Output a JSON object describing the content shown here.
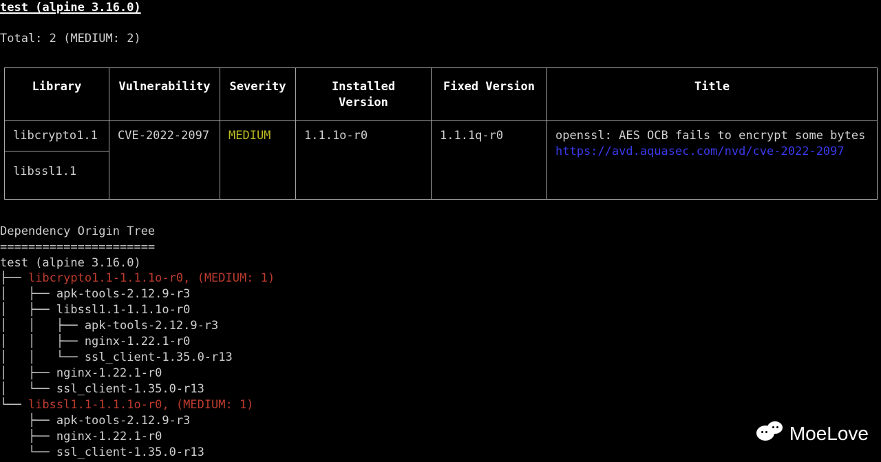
{
  "scan_target": "test (alpine 3.16.0)",
  "totals_line": "Total: 2 (MEDIUM: 2)",
  "table": {
    "headers": {
      "library": "Library",
      "vulnerability": "Vulnerability",
      "severity": "Severity",
      "installed_version": "Installed Version",
      "fixed_version": "Fixed Version",
      "title": "Title"
    },
    "rows": [
      {
        "library": "libcrypto1.1",
        "vulnerability": "CVE-2022-2097",
        "severity": "MEDIUM",
        "installed_version": "1.1.1o-r0",
        "fixed_version": "1.1.1q-r0",
        "title_text": "openssl: AES OCB fails to encrypt some bytes",
        "title_link": "https://avd.aquasec.com/nvd/cve-2022-2097"
      },
      {
        "library": "libssl1.1"
      }
    ]
  },
  "tree": {
    "heading": "Dependency Origin Tree",
    "separator": "======================",
    "root": "test (alpine 3.16.0)",
    "node1": {
      "branch": "├── ",
      "text": "libcrypto1.1-1.1.1o-r0, (MEDIUM: 1)"
    },
    "c1": "│   ├── apk-tools-2.12.9-r3",
    "c2": "│   ├── libssl1.1-1.1.1o-r0",
    "c3": "│   │   ├── apk-tools-2.12.9-r3",
    "c4": "│   │   ├── nginx-1.22.1-r0",
    "c5": "│   │   └── ssl_client-1.35.0-r13",
    "c6": "│   ├── nginx-1.22.1-r0",
    "c7": "│   └── ssl_client-1.35.0-r13",
    "node2": {
      "branch": "└── ",
      "text": "libssl1.1-1.1.1o-r0, (MEDIUM: 1)"
    },
    "c8": "    ├── apk-tools-2.12.9-r3",
    "c9": "    ├── nginx-1.22.1-r0",
    "c10": "    └── ssl_client-1.35.0-r13"
  },
  "watermark_text": "MoeLove"
}
